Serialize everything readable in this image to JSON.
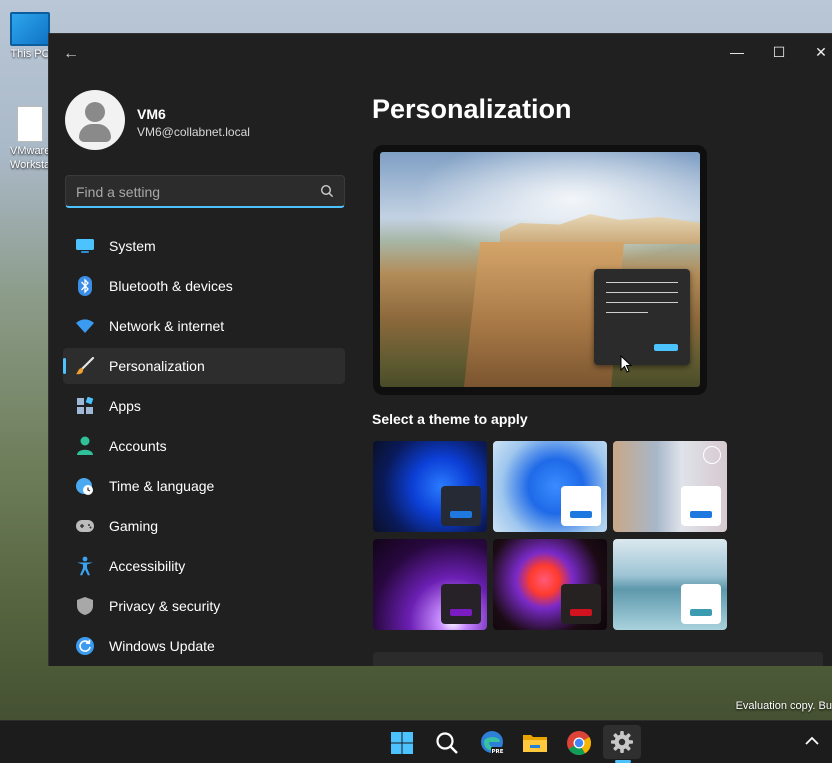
{
  "desktop": {
    "icons": [
      {
        "label": "This PC"
      },
      {
        "label": "VMware Workstation"
      }
    ],
    "watermark": "Evaluation copy. Bu"
  },
  "window": {
    "back_label": "←",
    "minimize_label": "—",
    "maximize_label": "☐",
    "close_label": "✕"
  },
  "profile": {
    "name": "VM6",
    "email": "VM6@collabnet.local"
  },
  "search": {
    "placeholder": "Find a setting",
    "value": ""
  },
  "nav": {
    "items": [
      {
        "label": "System",
        "icon": "monitor-icon",
        "color": "#4cc2ff"
      },
      {
        "label": "Bluetooth & devices",
        "icon": "bluetooth-icon",
        "color": "#3a8ee6"
      },
      {
        "label": "Network & internet",
        "icon": "wifi-icon",
        "color": "#3a9bf0"
      },
      {
        "label": "Personalization",
        "icon": "paintbrush-icon",
        "color": "#e0e0e0",
        "active": true
      },
      {
        "label": "Apps",
        "icon": "apps-icon",
        "color": "#9fb8d6"
      },
      {
        "label": "Accounts",
        "icon": "person-icon",
        "color": "#2fc29a"
      },
      {
        "label": "Time & language",
        "icon": "globe-clock-icon",
        "color": "#4aa9f0"
      },
      {
        "label": "Gaming",
        "icon": "gamepad-icon",
        "color": "#bcbcbc"
      },
      {
        "label": "Accessibility",
        "icon": "accessibility-icon",
        "color": "#3aa4f2"
      },
      {
        "label": "Privacy & security",
        "icon": "shield-icon",
        "color": "#a8a8a8"
      },
      {
        "label": "Windows Update",
        "icon": "update-icon",
        "color": "#3a9bf0"
      }
    ]
  },
  "main": {
    "title": "Personalization",
    "themes_heading": "Select a theme to apply",
    "themes": [
      {
        "accent": "#1e78e0",
        "chip": "#262a35"
      },
      {
        "accent": "#1e78e0",
        "chip": "#ffffff"
      },
      {
        "accent": "#1e78e0",
        "chip": "#ffffff"
      },
      {
        "accent": "#7a1cc2",
        "chip": "#262228"
      },
      {
        "accent": "#d1131f",
        "chip": "#262222"
      },
      {
        "accent": "#3b9bb0",
        "chip": "#ffffff"
      }
    ]
  },
  "taskbar": {
    "icons": [
      "start-icon",
      "search-icon",
      "edge-icon",
      "file-explorer-icon",
      "chrome-icon",
      "settings-icon"
    ],
    "accent": "#4cc2ff"
  }
}
